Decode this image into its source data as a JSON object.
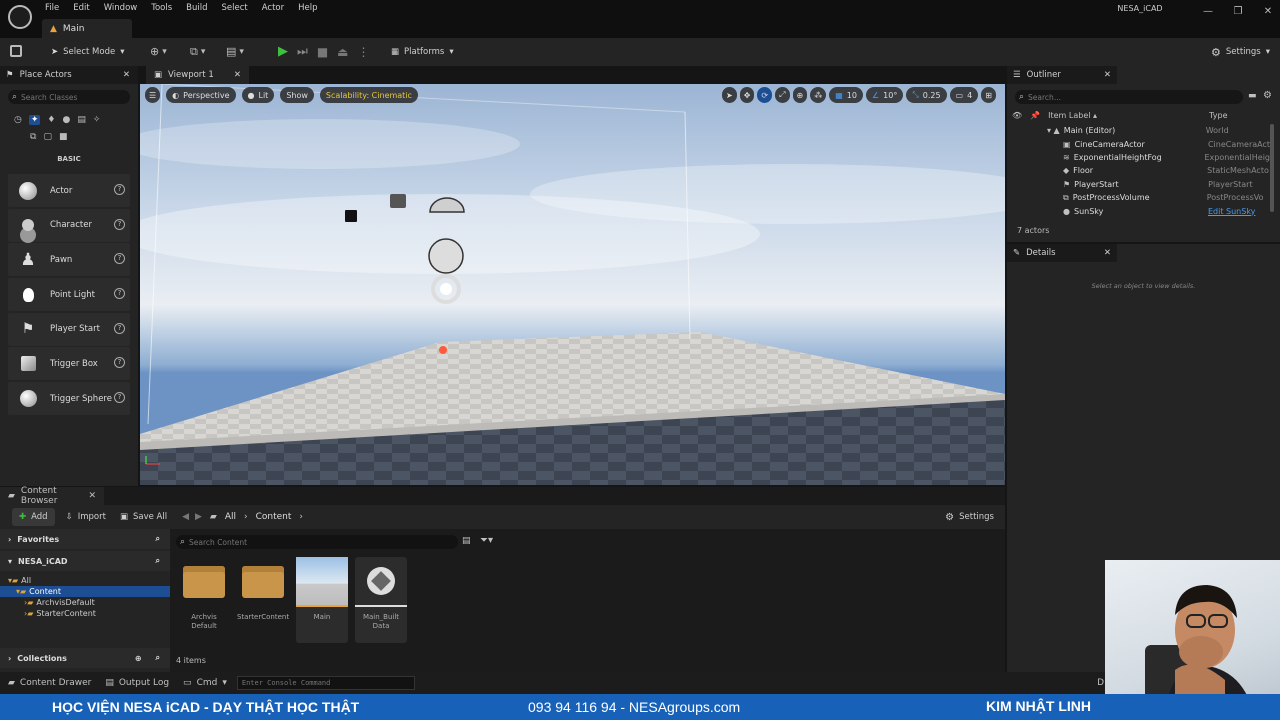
{
  "app": {
    "menu": [
      "File",
      "Edit",
      "Window",
      "Tools",
      "Build",
      "Select",
      "Actor",
      "Help"
    ],
    "level_tab": "Main",
    "project_name": "NESA_iCAD",
    "window_controls": [
      "—",
      "❐",
      "✕"
    ]
  },
  "toolbar": {
    "select_mode": "Select Mode",
    "platforms": "Platforms",
    "settings": "Settings"
  },
  "place_actors": {
    "tab": "Place Actors",
    "search_placeholder": "Search Classes",
    "category": "BASIC",
    "items": [
      {
        "label": "Actor",
        "icon": "sphere-icon"
      },
      {
        "label": "Character",
        "icon": "character-icon"
      },
      {
        "label": "Pawn",
        "icon": "pawn-icon"
      },
      {
        "label": "Point Light",
        "icon": "lightbulb-icon"
      },
      {
        "label": "Player Start",
        "icon": "flag-icon"
      },
      {
        "label": "Trigger Box",
        "icon": "box-icon"
      },
      {
        "label": "Trigger Sphere",
        "icon": "sphere-icon"
      }
    ]
  },
  "viewport": {
    "tab": "Viewport 1",
    "perspective": "Perspective",
    "lit": "Lit",
    "show": "Show",
    "scalability": "Scalability: Cinematic",
    "grid_snap": "10",
    "rot_snap": "10°",
    "scale_snap": "0.25",
    "camera_speed": "4"
  },
  "outliner": {
    "tab": "Outliner",
    "search_placeholder": "Search...",
    "col_label": "Item Label ▴",
    "col_type": "Type",
    "root": {
      "label": "Main (Editor)",
      "type": "World"
    },
    "rows": [
      {
        "label": "CineCameraActor",
        "type": "CineCameraAct"
      },
      {
        "label": "ExponentialHeightFog",
        "type": "ExponentialHeig"
      },
      {
        "label": "Floor",
        "type": "StaticMeshActo"
      },
      {
        "label": "PlayerStart",
        "type": "PlayerStart"
      },
      {
        "label": "PostProcessVolume",
        "type": "PostProcessVo"
      },
      {
        "label": "SunSky",
        "type": "Edit SunSky"
      }
    ],
    "count": "7 actors"
  },
  "details": {
    "tab": "Details",
    "empty": "Select an object to view details."
  },
  "content_browser": {
    "tab": "Content Browser",
    "add": "Add",
    "import": "Import",
    "save_all": "Save All",
    "path": [
      "All",
      "Content"
    ],
    "settings": "Settings",
    "favorites": "Favorites",
    "project": "NESA_iCAD",
    "tree": [
      "All",
      "Content",
      "ArchvisDefault",
      "StarterContent"
    ],
    "collections": "Collections",
    "search_placeholder": "Search Content",
    "assets": [
      {
        "name": "Archvis Default",
        "kind": "folder"
      },
      {
        "name": "StarterContent",
        "kind": "folder"
      },
      {
        "name": "Main",
        "kind": "level"
      },
      {
        "name": "Main_Built Data",
        "kind": "data"
      }
    ],
    "count": "4 items"
  },
  "statusbar": {
    "content_drawer": "Content Drawer",
    "output_log": "Output Log",
    "cmd": "Cmd",
    "console_placeholder": "Enter Console Command",
    "derived": "D"
  },
  "banner": {
    "left": "HỌC VIỆN NESA iCAD - DẠY THẬT HỌC THẬT",
    "center": "093 94 116 94 - NESAgroups.com",
    "right": "KIM NHẬT LINH"
  },
  "colors": {
    "banner_bg": "#1761b8",
    "play_green": "#3fbf3f",
    "scalability_yellow": "#e8c43a",
    "link_blue": "#4a9cf0"
  }
}
